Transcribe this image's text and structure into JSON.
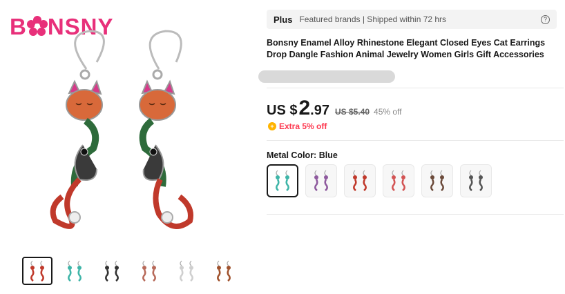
{
  "brand": {
    "logo_text_a": "B",
    "logo_text_b": "NSNY"
  },
  "gallery": {
    "thumbnails": [
      {
        "name": "thumb-1",
        "color": "#c0392b",
        "active": true
      },
      {
        "name": "thumb-2",
        "color": "#3fb5a8",
        "active": false
      },
      {
        "name": "thumb-3",
        "color": "#333333",
        "active": false
      },
      {
        "name": "thumb-4",
        "color": "#b86a5a",
        "active": false
      },
      {
        "name": "thumb-5",
        "color": "#cfcfcf",
        "active": false
      },
      {
        "name": "thumb-6",
        "color": "#a0522d",
        "active": false
      }
    ]
  },
  "plus_bar": {
    "plus_label": "Plus",
    "text": "Featured brands | Shipped within 72 hrs",
    "help_icon": "?"
  },
  "product": {
    "title": "Bonsny Enamel Alloy Rhinestone Elegant Closed Eyes Cat Earrings Drop Dangle Fashion Animal Jewelry Women Girls Gift Accessories"
  },
  "price": {
    "currency": "US $",
    "integer": "2",
    "decimal": ".97",
    "original": "US $5.40",
    "discount": "45% off",
    "extra_icon": "+",
    "extra": "Extra 5% off"
  },
  "variant": {
    "label": "Metal Color:",
    "selected": "Blue",
    "options": [
      {
        "color": "#3fb5a8",
        "selected": true
      },
      {
        "color": "#8e5a9e",
        "selected": false
      },
      {
        "color": "#c0392b",
        "selected": false
      },
      {
        "color": "#d35454",
        "selected": false
      },
      {
        "color": "#6b4a3a",
        "selected": false
      },
      {
        "color": "#555555",
        "selected": false
      }
    ]
  },
  "colors": {
    "accent": "#fd384f",
    "brand_pink": "#e8307a",
    "coin": "#ffb400"
  }
}
